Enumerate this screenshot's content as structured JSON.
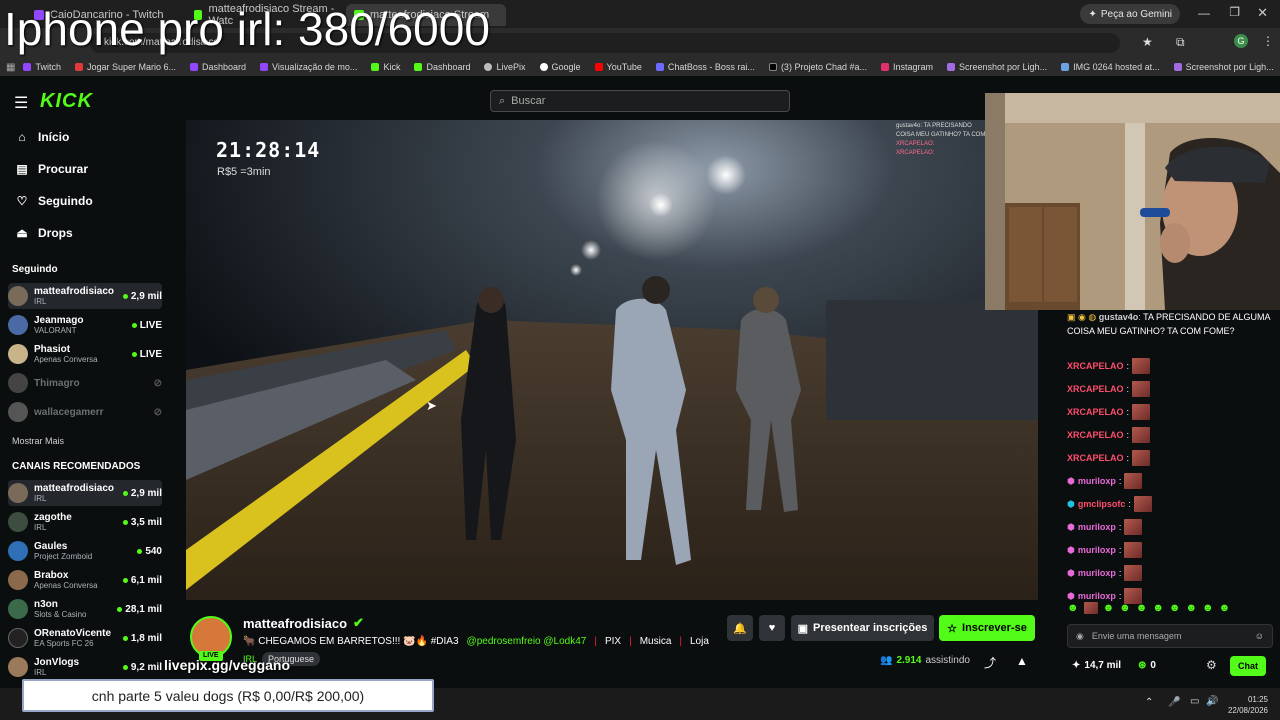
{
  "overlay_title": "Iphone pro irl: 380/6000",
  "browser": {
    "tabs": [
      "CaioDancarino - Twitch",
      "matteafrodisiaco Stream - Watc",
      "matteafrodisiaco Stream"
    ],
    "gemini_label": "Peça ao Gemini",
    "address": "kick.com/matteafrodisiaco",
    "bookmarks": [
      "Twitch",
      "Jogar Super Mario 6...",
      "Dashboard",
      "Visualização de mo...",
      "Kick",
      "Dashboard",
      "LivePix",
      "Google",
      "YouTube",
      "ChatBoss - Boss rai...",
      "(3) Projeto Chad #a...",
      "Instagram",
      "Screenshot por Ligh...",
      "IMG 0264 hosted at...",
      "Screenshot por Ligh..."
    ]
  },
  "kick": {
    "logo": "KICK",
    "search_placeholder": "Buscar"
  },
  "nav": {
    "home": "Início",
    "browse": "Procurar",
    "following": "Seguindo",
    "drops": "Drops"
  },
  "following_header": "Seguindo",
  "following": [
    {
      "name": "matteafrodisiaco",
      "sub": "IRL",
      "viewers": "2,9 mil",
      "live": true
    },
    {
      "name": "Jeanmago",
      "sub": "VALORANT",
      "viewers": "LIVE",
      "live": true
    },
    {
      "name": "Phasiot",
      "sub": "Apenas Conversa",
      "viewers": "LIVE",
      "live": true
    },
    {
      "name": "Thimagro",
      "sub": "",
      "viewers": "",
      "live": false
    },
    {
      "name": "wallacegamerr",
      "sub": "",
      "viewers": "",
      "live": false
    }
  ],
  "show_more": "Mostrar Mais",
  "recommended_header": "CANAIS RECOMENDADOS",
  "recommended": [
    {
      "name": "matteafrodisiaco",
      "sub": "IRL",
      "viewers": "2,9 mil"
    },
    {
      "name": "zagothe",
      "sub": "IRL",
      "viewers": "3,5 mil"
    },
    {
      "name": "Gaules",
      "sub": "Project Zomboid",
      "viewers": "540"
    },
    {
      "name": "Brabox",
      "sub": "Apenas Conversa",
      "viewers": "6,1 mil"
    },
    {
      "name": "n3on",
      "sub": "Slots & Casino",
      "viewers": "28,1 mil"
    },
    {
      "name": "ORenatoVicente",
      "sub": "EA Sports FC 26",
      "viewers": "1,8 mil"
    },
    {
      "name": "JonVlogs",
      "sub": "IRL",
      "viewers": "9,2 mil"
    }
  ],
  "video": {
    "clock": "21:28:14",
    "rate": "R$5 =3min"
  },
  "stream": {
    "channel": "matteafrodisiaco",
    "title_parts": [
      "🐂 CHEGAMOS EM BARRETOS!!! 🐷🔥 #DIA3",
      "@pedrosemfreio @Lodk47",
      "PIX",
      "Musica",
      "Loja"
    ],
    "category": "IRL",
    "language": "Portuguese",
    "gift_label": "Presentear inscrições",
    "subscribe_label": "Inscrever-se",
    "viewers": "2.914",
    "viewers_label": "assistindo",
    "live_badge": "LIVE"
  },
  "chat": {
    "first_user": "gustav4o",
    "first_text": "TA PRECISANDO DE ALGUMA COISA MEU GATINHO? TA COM FOME?",
    "messages": [
      {
        "user": "XRCAPELAO",
        "color": "#ff4d6d"
      },
      {
        "user": "XRCAPELAO",
        "color": "#ff4d6d"
      },
      {
        "user": "XRCAPELAO",
        "color": "#ff4d6d"
      },
      {
        "user": "XRCAPELAO",
        "color": "#ff4d6d"
      },
      {
        "user": "XRCAPELAO",
        "color": "#ff4d6d"
      },
      {
        "user": "muriloxp",
        "color": "#e86ad8"
      },
      {
        "user": "gmclipsofc",
        "color": "#ff4d6d"
      },
      {
        "user": "muriloxp",
        "color": "#e86ad8"
      },
      {
        "user": "muriloxp",
        "color": "#e86ad8"
      },
      {
        "user": "muriloxp",
        "color": "#e86ad8"
      },
      {
        "user": "muriloxp",
        "color": "#e86ad8"
      }
    ],
    "input_placeholder": "Envie uma mensagem",
    "points": "14,7 mil",
    "coins": "0",
    "send_label": "Chat"
  },
  "overlay": {
    "livepix": "livepix.gg/veggano",
    "donation": "cnh parte 5 valeu dogs (R$ 0,00/R$ 200,00)"
  },
  "taskbar": {
    "time": "01:25",
    "date": "22/08/2026"
  }
}
